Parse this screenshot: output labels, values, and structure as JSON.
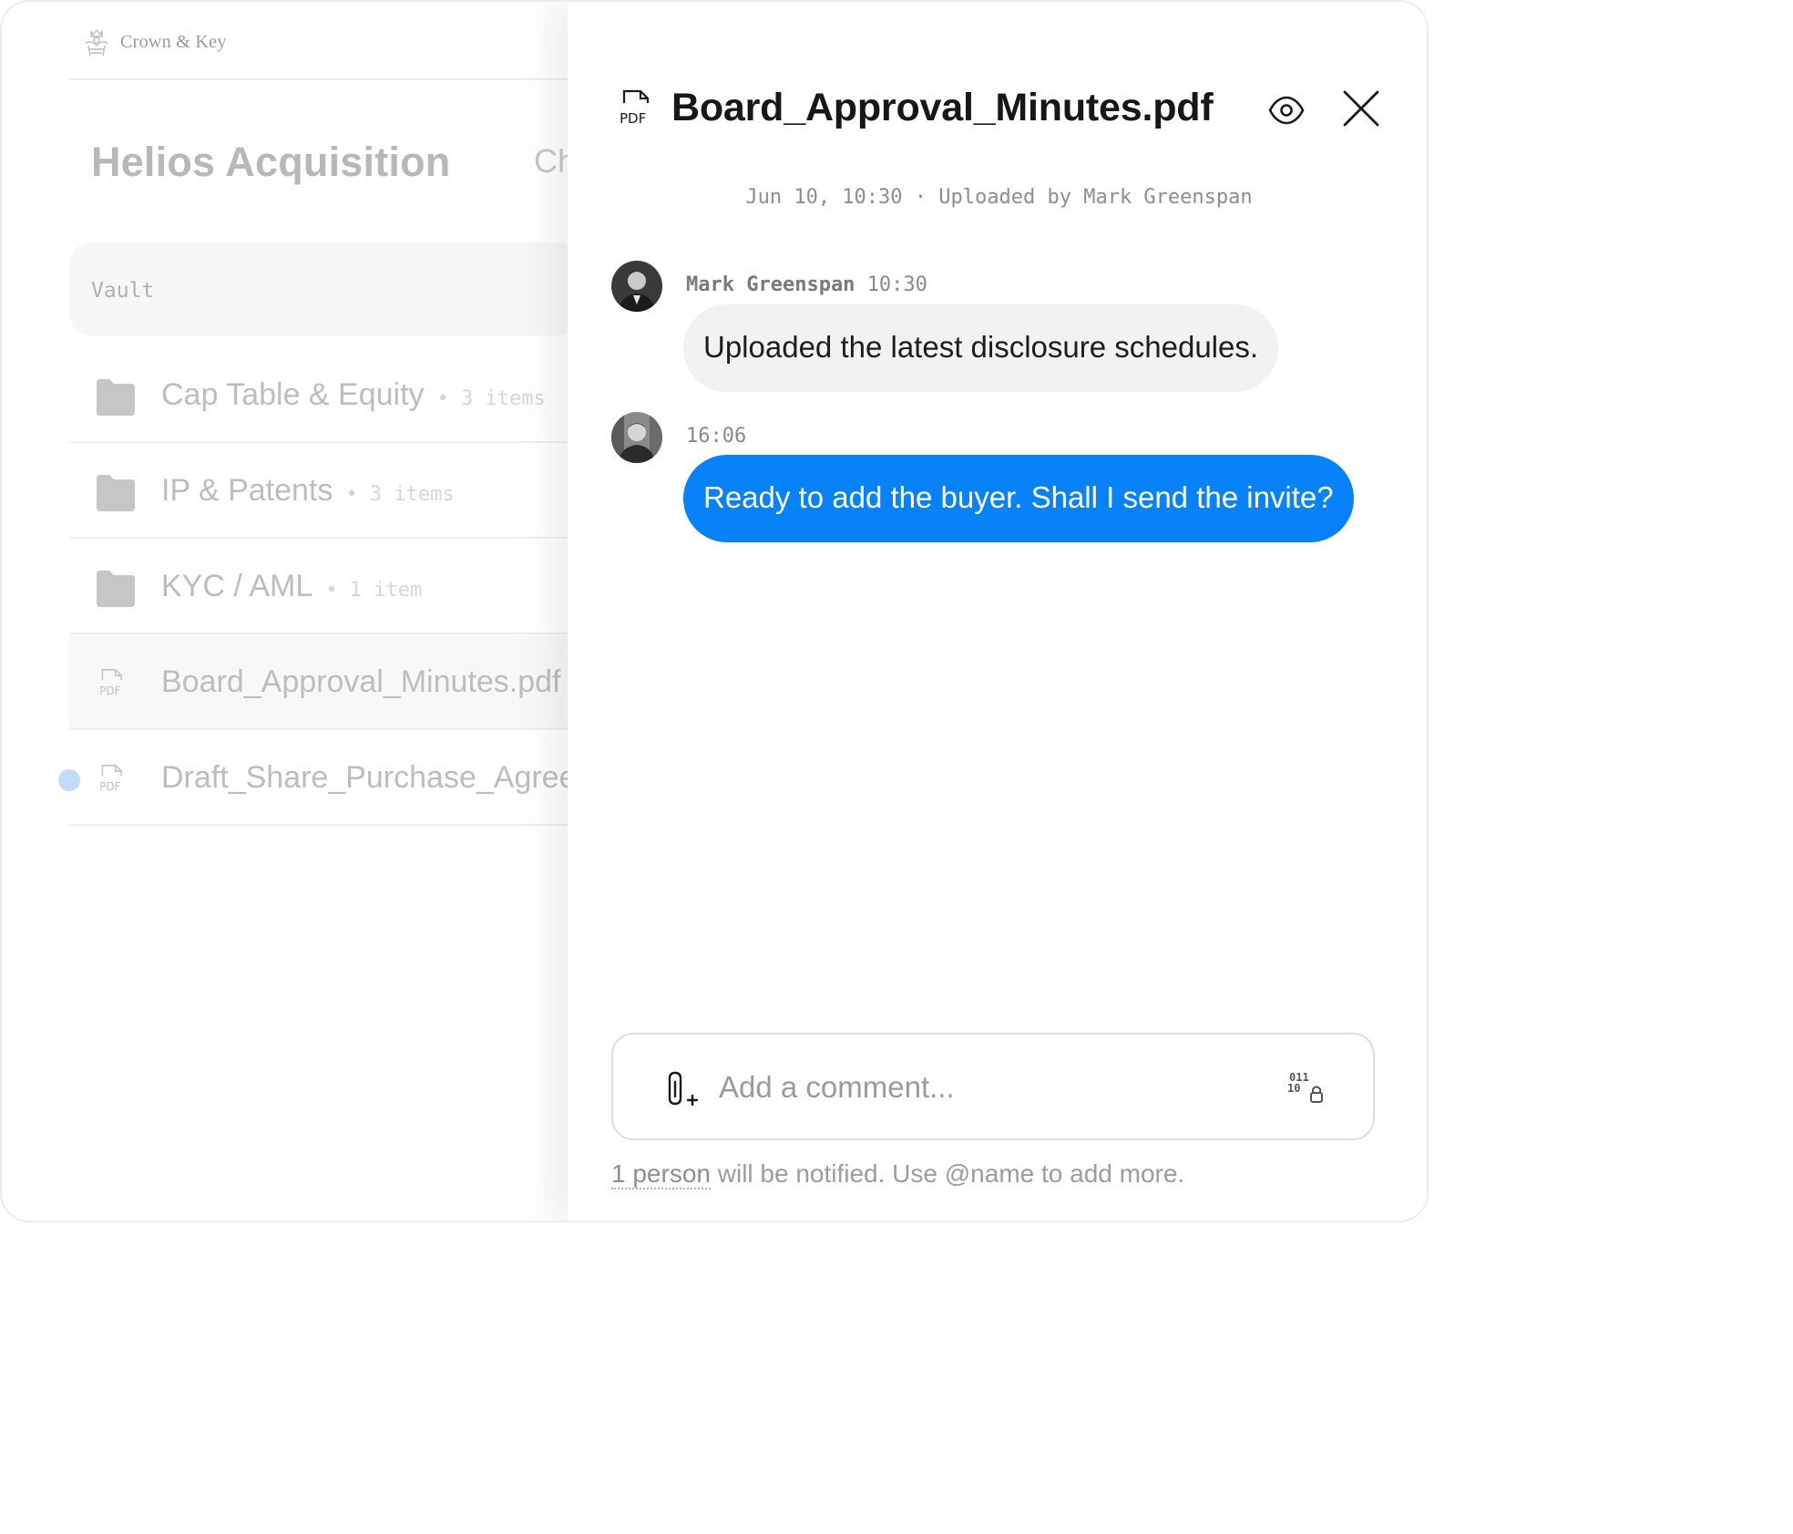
{
  "brand": {
    "name": "Crown & Key",
    "logo_icon": "crest-icon"
  },
  "vault_page": {
    "title": "Helios Acquisition",
    "partial_tab": "Ch",
    "breadcrumb": "Vault",
    "items": [
      {
        "name": "Cap Table & Equity",
        "count": "• 3 items",
        "icon": "folder-icon"
      },
      {
        "name": "IP & Patents",
        "count": "• 3 items",
        "icon": "folder-icon"
      },
      {
        "name": "KYC / AML",
        "count": "• 1 item",
        "icon": "folder-icon"
      },
      {
        "name": "Board_Approval_Minutes.pdf",
        "count": "",
        "icon": "pdf-icon",
        "selected": true
      },
      {
        "name": "Draft_Share_Purchase_Agree",
        "count": "",
        "icon": "pdf-icon",
        "unread": true
      }
    ]
  },
  "drawer": {
    "file_icon_label": "PDF",
    "title": "Board_Approval_Minutes.pdf",
    "meta": "Jun 10, 10:30 · Uploaded by Mark Greenspan",
    "messages": [
      {
        "author": "Mark Greenspan",
        "time": "10:30",
        "text": "Uploaded the latest disclosure schedules.",
        "mine": false
      },
      {
        "author": "",
        "time": "16:06",
        "text": "Ready to add the buyer. Shall I send the invite?",
        "mine": true
      }
    ],
    "composer": {
      "placeholder": "Add a comment...",
      "value": ""
    },
    "notify": {
      "link": "1 person",
      "rest": " will be notified. Use @name to add more."
    }
  },
  "colors": {
    "accent": "#0782f9",
    "unread_dot": "#bfdcfb",
    "bubble_other": "#f2f2f1"
  }
}
